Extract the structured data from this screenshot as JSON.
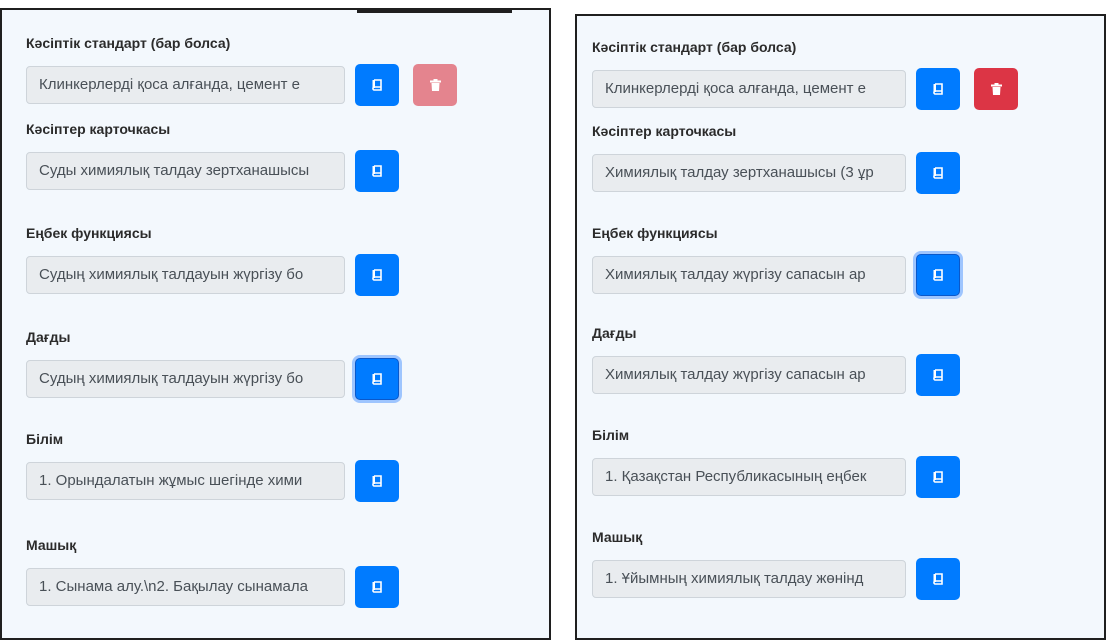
{
  "colors": {
    "primary": "#007bff",
    "danger": "#dc3545",
    "danger_disabled": "#e4848e",
    "input_bg": "#e9ecef",
    "panel_bg": "#f3f8fd"
  },
  "left_panel": {
    "fields": [
      {
        "label": "Кәсіптік стандарт (бар болса)",
        "value": "Клинкерлерді қоса алғанда, цемент е"
      },
      {
        "label": "Кәсіптер карточкасы",
        "value": "Суды химиялық талдау зертханашысы"
      },
      {
        "label": "Еңбек функциясы",
        "value": "Судың химиялық талдауын жүргізу бо"
      },
      {
        "label": "Дағды",
        "value": "Судың химиялық талдауын жүргізу бо"
      },
      {
        "label": "Білім",
        "value": "1. Орындалатын жұмыс шегінде хими"
      },
      {
        "label": "Машық",
        "value": "1. Сынама алу.\\n2. Бақылау сынамала"
      }
    ]
  },
  "right_panel": {
    "fields": [
      {
        "label": "Кәсіптік стандарт (бар болса)",
        "value": "Клинкерлерді қоса алғанда, цемент е"
      },
      {
        "label": "Кәсіптер карточкасы",
        "value": "Химиялық талдау зертханашысы (3 ұр"
      },
      {
        "label": "Еңбек функциясы",
        "value": "Химиялық талдау жүргізу сапасын ар"
      },
      {
        "label": "Дағды",
        "value": "Химиялық талдау жүргізу сапасын ар"
      },
      {
        "label": "Білім",
        "value": "1. Қазақстан Республикасының еңбек"
      },
      {
        "label": "Машық",
        "value": "1. Ұйымның химиялық талдау жөнінд"
      }
    ]
  },
  "icons": {
    "book": "book-icon",
    "trash": "trash-icon"
  }
}
